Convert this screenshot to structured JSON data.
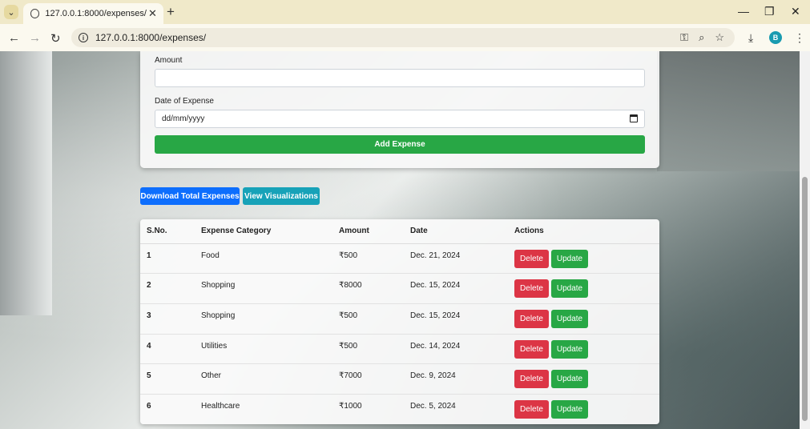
{
  "browser": {
    "tab_title": "127.0.0.1:8000/expenses/",
    "url": "127.0.0.1:8000/expenses/",
    "profile_initial": "B"
  },
  "form": {
    "amount_label": "Amount",
    "amount_value": "",
    "date_label": "Date of Expense",
    "date_placeholder": "dd/mm/yyyy",
    "submit_label": "Add Expense"
  },
  "actions": {
    "download_label": "Download Total Expenses",
    "visualize_label": "View Visualizations"
  },
  "table": {
    "headers": [
      "S.No.",
      "Expense Category",
      "Amount",
      "Date",
      "Actions"
    ],
    "rows": [
      {
        "sno": "1",
        "category": "Food",
        "amount": "₹500",
        "date": "Dec. 21, 2024"
      },
      {
        "sno": "2",
        "category": "Shopping",
        "amount": "₹8000",
        "date": "Dec. 15, 2024"
      },
      {
        "sno": "3",
        "category": "Shopping",
        "amount": "₹500",
        "date": "Dec. 15, 2024"
      },
      {
        "sno": "4",
        "category": "Utilities",
        "amount": "₹500",
        "date": "Dec. 14, 2024"
      },
      {
        "sno": "5",
        "category": "Other",
        "amount": "₹7000",
        "date": "Dec. 9, 2024"
      },
      {
        "sno": "6",
        "category": "Healthcare",
        "amount": "₹1000",
        "date": "Dec. 5, 2024"
      }
    ],
    "delete_label": "Delete",
    "update_label": "Update"
  },
  "colors": {
    "success": "#28a745",
    "primary": "#0d6efd",
    "info": "#17a2b8",
    "danger": "#dc3545"
  }
}
